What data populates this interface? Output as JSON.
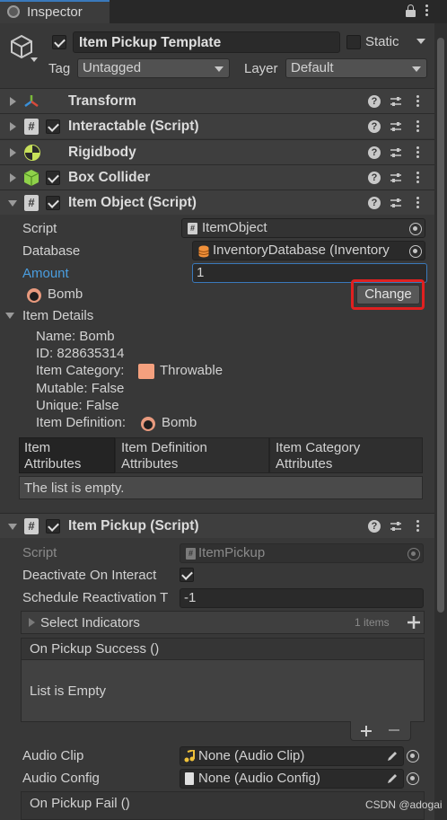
{
  "window": {
    "tab_label": "Inspector"
  },
  "gameobject": {
    "name": "Item Pickup Template",
    "static_label": "Static",
    "tag_label": "Tag",
    "tag_value": "Untagged",
    "layer_label": "Layer",
    "layer_value": "Default"
  },
  "components": [
    {
      "title": "Transform"
    },
    {
      "title": "Interactable (Script)"
    },
    {
      "title": "Rigidbody"
    },
    {
      "title": "Box Collider"
    },
    {
      "title": "Item Object (Script)"
    },
    {
      "title": "Item Pickup (Script)"
    }
  ],
  "item_object": {
    "script_label": "Script",
    "script_value": "ItemObject",
    "database_label": "Database",
    "database_value": "InventoryDatabase (Inventory",
    "amount_label": "Amount",
    "amount_value": "1",
    "item_name": "Bomb",
    "change_button": "Change",
    "details_label": "Item Details",
    "details": {
      "name": "Name: Bomb",
      "id": "ID: 828635314",
      "category_label": "Item Category:",
      "category_value": "Throwable",
      "mutable": "Mutable: False",
      "unique": "Unique: False",
      "definition_label": "Item Definition:",
      "definition_value": "Bomb"
    },
    "tabs": [
      "Item Attributes",
      "Item Definition Attributes",
      "Item Category Attributes"
    ],
    "tab_lines": [
      [
        "Item",
        "Attributes"
      ],
      [
        "Item Definition",
        "Attributes"
      ],
      [
        "Item Category",
        "Attributes"
      ]
    ],
    "list_empty": "The list is empty."
  },
  "item_pickup": {
    "script_label": "Script",
    "script_value": "ItemPickup",
    "deactivate_label": "Deactivate On Interact",
    "schedule_label": "Schedule Reactivation T",
    "schedule_value": "-1",
    "indicators_label": "Select Indicators",
    "indicators_count": "1 items",
    "on_success_label": "On Pickup Success ()",
    "list_is_empty": "List is Empty",
    "audio_clip_label": "Audio Clip",
    "audio_clip_value": "None (Audio Clip)",
    "audio_config_label": "Audio Config",
    "audio_config_value": "None (Audio Config)",
    "on_fail_label": "On Pickup Fail ()"
  },
  "watermark": "CSDN @adogai",
  "colors": {
    "accent": "#3a79bb",
    "highlight_box": "#e02020",
    "amount_label": "#4a9ee0",
    "category_swatch": "#f4a07e"
  }
}
